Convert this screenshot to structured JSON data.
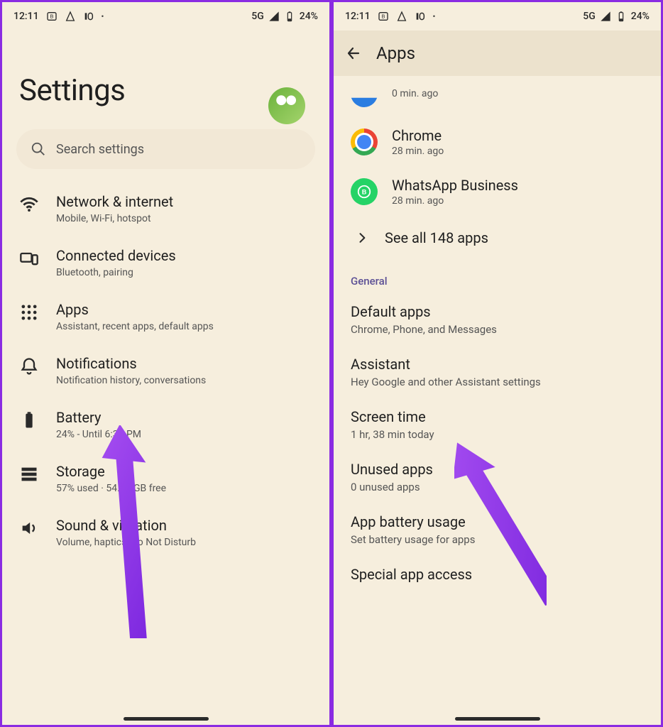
{
  "status": {
    "time": "12:11",
    "network": "5G",
    "battery": "24%"
  },
  "left": {
    "title": "Settings",
    "searchPlaceholder": "Search settings",
    "items": {
      "network": {
        "title": "Network & internet",
        "sub": "Mobile, Wi-Fi, hotspot"
      },
      "devices": {
        "title": "Connected devices",
        "sub": "Bluetooth, pairing"
      },
      "apps": {
        "title": "Apps",
        "sub": "Assistant, recent apps, default apps"
      },
      "notifs": {
        "title": "Notifications",
        "sub": "Notification history, conversations"
      },
      "battery": {
        "title": "Battery",
        "sub": "24% - Until 6:30 PM"
      },
      "storage": {
        "title": "Storage",
        "sub": "57% used · 54.72 GB free"
      },
      "sound": {
        "title": "Sound & vibration",
        "sub": "Volume, haptics, Do Not Disturb"
      }
    }
  },
  "right": {
    "title": "Apps",
    "recent": {
      "partial": {
        "sub": "0 min. ago"
      },
      "chrome": {
        "title": "Chrome",
        "sub": "28 min. ago"
      },
      "whatsapp": {
        "title": "WhatsApp Business",
        "sub": "28 min. ago"
      }
    },
    "seeAll": "See all 148 apps",
    "sectionLabel": "General",
    "general": {
      "default": {
        "title": "Default apps",
        "sub": "Chrome, Phone, and Messages"
      },
      "assistant": {
        "title": "Assistant",
        "sub": "Hey Google and other Assistant settings"
      },
      "screen": {
        "title": "Screen time",
        "sub": "1 hr, 38 min today"
      },
      "unused": {
        "title": "Unused apps",
        "sub": "0 unused apps"
      },
      "appbatt": {
        "title": "App battery usage",
        "sub": "Set battery usage for apps"
      },
      "special": {
        "title": "Special app access"
      }
    }
  }
}
